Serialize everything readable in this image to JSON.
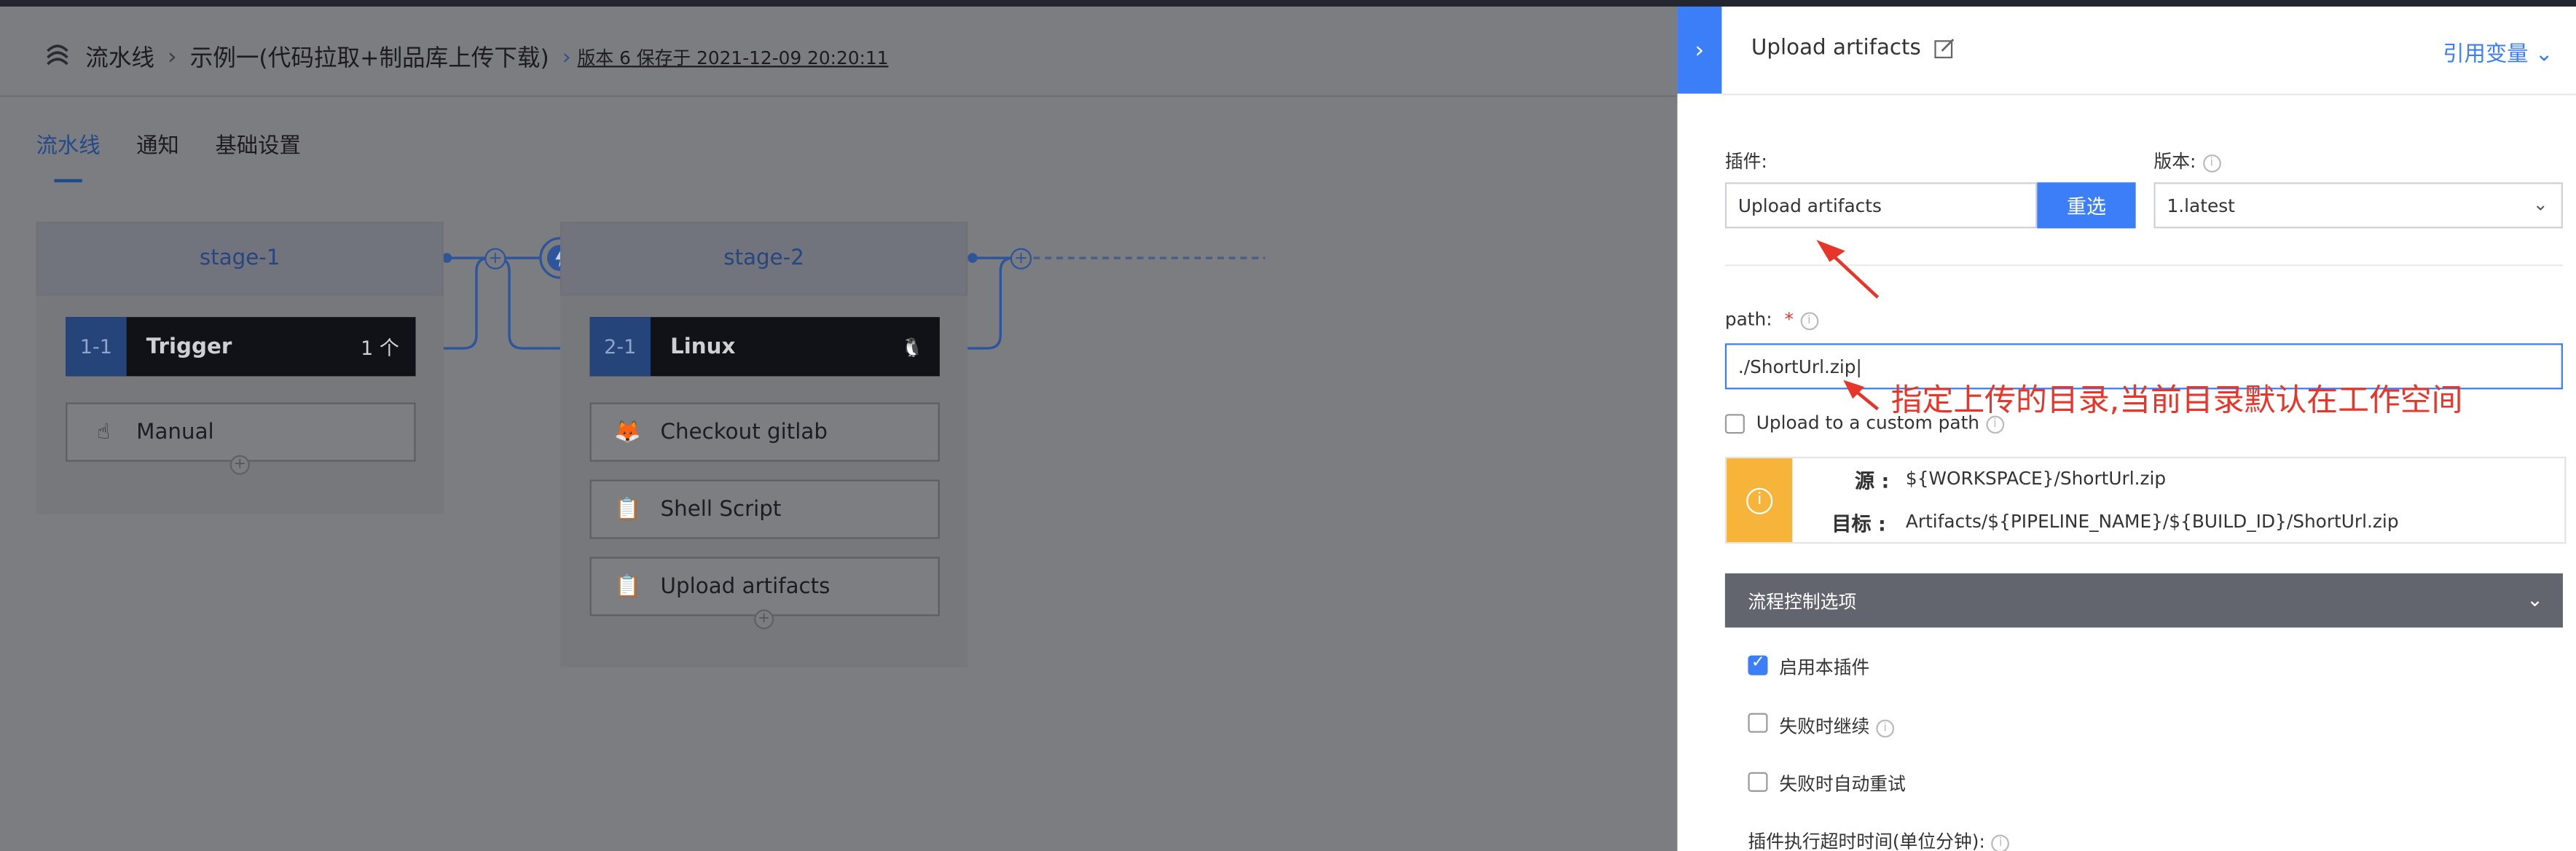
{
  "breadcrumb": {
    "root": "流水线",
    "pipeline": "示例一(代码拉取+制品库上传下载)",
    "version_info": "版本 6 保存于 2021-12-09 20:20:11"
  },
  "tabs": [
    {
      "label": "流水线",
      "active": true
    },
    {
      "label": "通知",
      "active": false
    },
    {
      "label": "基础设置",
      "active": false
    }
  ],
  "stages": [
    {
      "title": "stage-1",
      "job": {
        "id": "1-1",
        "name": "Trigger",
        "extra": "1 个"
      },
      "tasks": [
        {
          "label": "Manual",
          "icon": "hand-icon"
        }
      ]
    },
    {
      "title": "stage-2",
      "job": {
        "id": "2-1",
        "name": "Linux",
        "extra": "🐧"
      },
      "tasks": [
        {
          "label": "Checkout gitlab",
          "icon": "gitlab-icon"
        },
        {
          "label": "Shell Script",
          "icon": "clipboard-icon"
        },
        {
          "label": "Upload artifacts",
          "icon": "clipboard-icon"
        }
      ]
    }
  ],
  "panel": {
    "title": "Upload artifacts",
    "ref_variable": "引用变量",
    "plugin_label": "插件:",
    "plugin_value": "Upload artifacts",
    "reselect_button": "重选",
    "version_label": "版本:",
    "version_value": "1.latest",
    "path_label": "path:",
    "path_value": "./ShortUrl.zip",
    "custom_path_label": "Upload to a custom path",
    "source_key": "源 :",
    "source_value": "${WORKSPACE}/ShortUrl.zip",
    "target_key": "目标 :",
    "target_value": "Artifacts/${PIPELINE_NAME}/${BUILD_ID}/ShortUrl.zip",
    "flow_control_title": "流程控制选项",
    "options": [
      {
        "label": "启用本插件",
        "checked": true,
        "info": false
      },
      {
        "label": "失败时继续",
        "checked": false,
        "info": true
      },
      {
        "label": "失败时自动重试",
        "checked": false,
        "info": false
      }
    ],
    "timeout_label": "插件执行超时时间(单位分钟):"
  },
  "annotation": "指定上传的目录,当前目录默认在工作空间"
}
